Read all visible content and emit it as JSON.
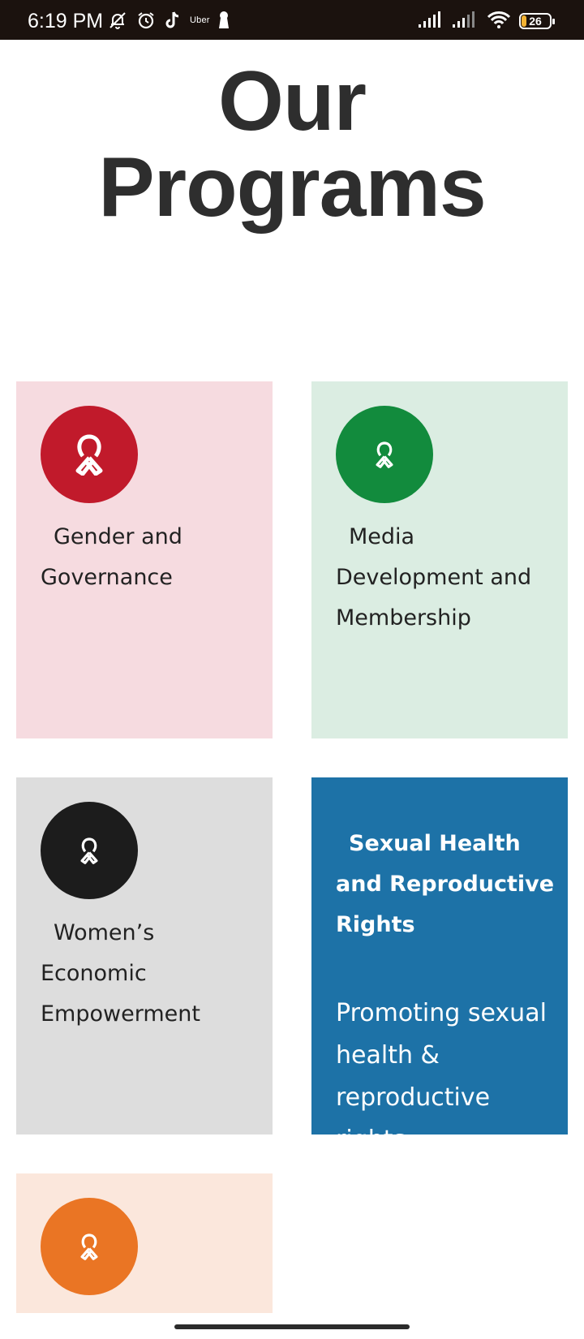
{
  "status_bar": {
    "time": "6:19 PM",
    "uber_label": "Uber",
    "battery_level": "26"
  },
  "page": {
    "title_line1": "Our",
    "title_line2": "Programs"
  },
  "programs": [
    {
      "title": "Gender and Governance",
      "icon": "awareness-ribbon-icon",
      "color": "#c11a2b",
      "card_color": "#f6dbe0"
    },
    {
      "title": "Media Development and Membership",
      "icon": "awareness-ribbon-icon",
      "color": "#128b3d",
      "card_color": "#dbede2"
    },
    {
      "title": "Women’s Economic Empowerment",
      "icon": "awareness-ribbon-icon",
      "color": "#1c1c1c",
      "card_color": "#dddddd"
    },
    {
      "title": "Sexual Health and Reproductive Rights",
      "description": "Promoting sexual health & reproductive rights",
      "card_color": "#1d72a7"
    },
    {
      "icon": "awareness-ribbon-icon",
      "color": "#ea7524",
      "card_color": "#fbe7dc"
    }
  ]
}
